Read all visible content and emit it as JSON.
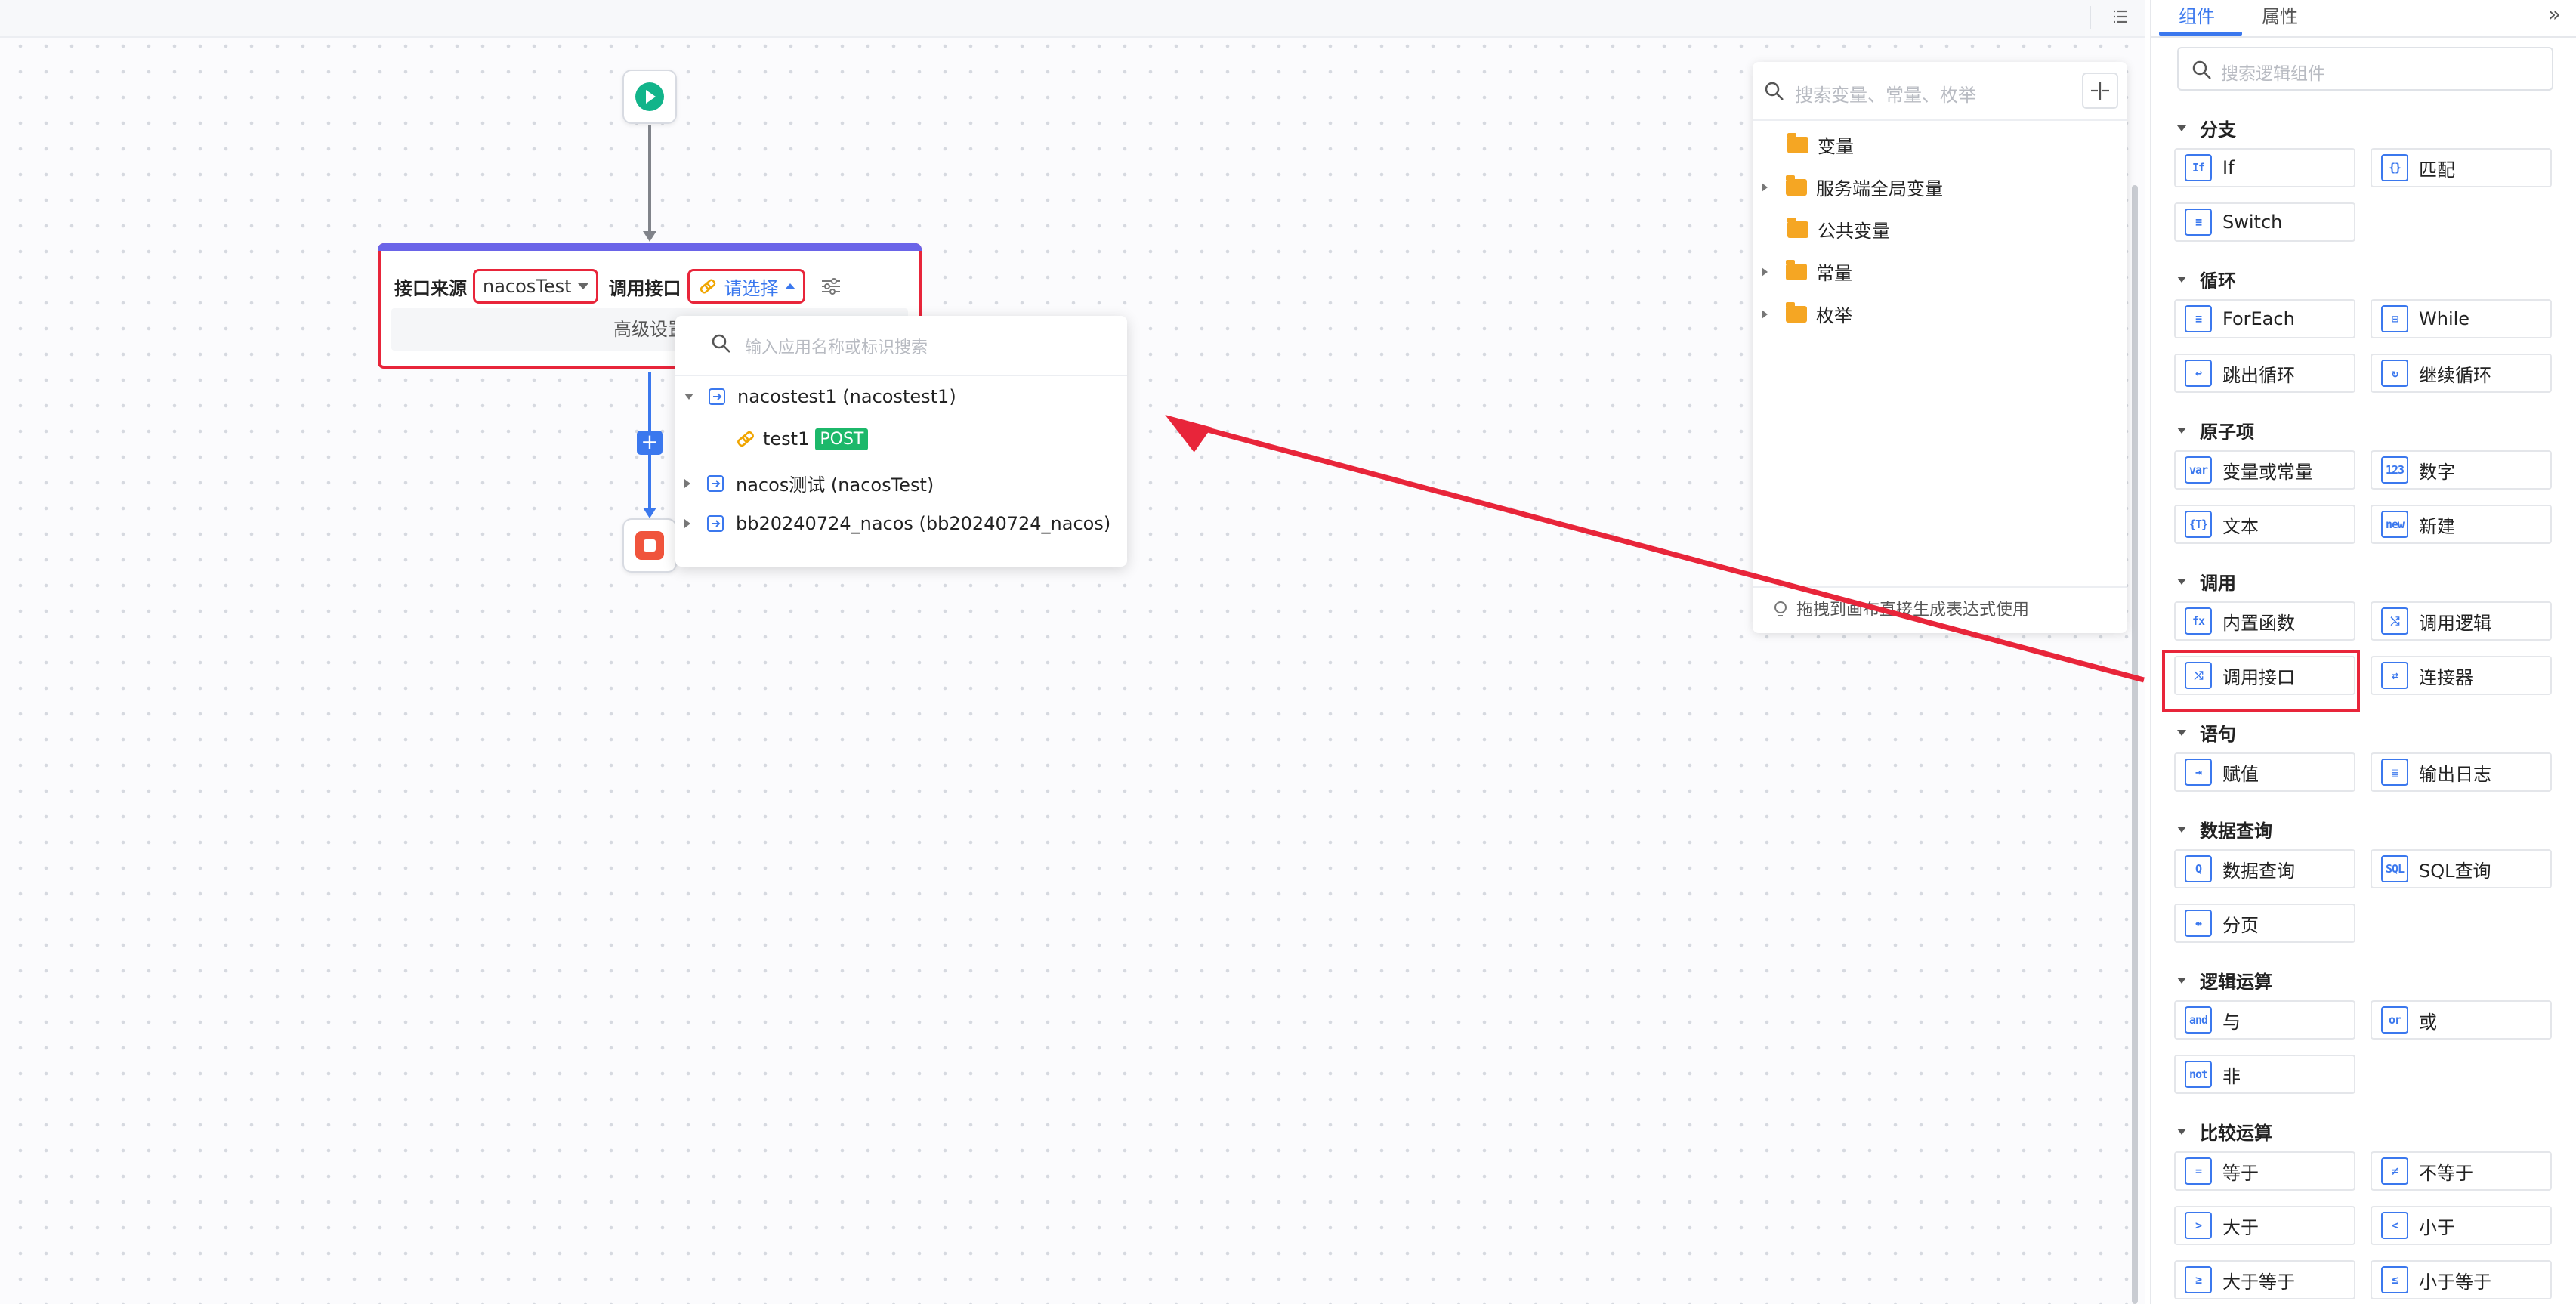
{
  "canvas": {
    "call_node": {
      "source_label": "接口来源",
      "source_value": "nacosTest",
      "api_label": "调用接口",
      "api_value": "请选择",
      "advanced_label": "高级设置"
    },
    "api_dropdown": {
      "search_placeholder": "输入应用名称或标识搜索",
      "items": [
        {
          "label": "nacostest1 (nacostest1)",
          "expanded": true
        },
        {
          "label": "test1",
          "method": "POST"
        },
        {
          "label": "nacos测试 (nacosTest)",
          "expanded": false
        },
        {
          "label": "bb20240724_nacos (bb20240724_nacos)",
          "expanded": false
        }
      ]
    }
  },
  "variables_panel": {
    "search_placeholder": "搜索变量、常量、枚举",
    "items": [
      {
        "label": "变量",
        "has_children": false
      },
      {
        "label": "服务端全局变量",
        "has_children": true
      },
      {
        "label": "公共变量",
        "has_children": false
      },
      {
        "label": "常量",
        "has_children": true
      },
      {
        "label": "枚举",
        "has_children": true
      }
    ],
    "footer": "拖拽到画布直接生成表达式使用"
  },
  "right_panel": {
    "tabs": [
      {
        "label": "组件",
        "active": true
      },
      {
        "label": "属性",
        "active": false
      }
    ],
    "search_placeholder": "搜索逻辑组件",
    "categories": {
      "branch": {
        "title": "分支",
        "items": [
          {
            "icon": "If",
            "label": "If"
          },
          {
            "icon": "{}",
            "label": "匹配"
          },
          {
            "icon": "≡",
            "label": "Switch"
          }
        ]
      },
      "loop": {
        "title": "循环",
        "items": [
          {
            "icon": "≡",
            "label": "ForEach"
          },
          {
            "icon": "⊟",
            "label": "While"
          },
          {
            "icon": "↩",
            "label": "跳出循环"
          },
          {
            "icon": "↻",
            "label": "继续循环"
          }
        ]
      },
      "atom": {
        "title": "原子项",
        "items": [
          {
            "icon": "var",
            "label": "变量或常量"
          },
          {
            "icon": "123",
            "label": "数字"
          },
          {
            "icon": "{T}",
            "label": "文本"
          },
          {
            "icon": "new",
            "label": "新建"
          }
        ]
      },
      "call": {
        "title": "调用",
        "items": [
          {
            "icon": "fx",
            "label": "内置函数"
          },
          {
            "icon": "⤭",
            "label": "调用逻辑"
          },
          {
            "icon": "⤭",
            "label": "调用接口"
          },
          {
            "icon": "⇄",
            "label": "连接器"
          }
        ]
      },
      "statement": {
        "title": "语句",
        "items": [
          {
            "icon": "⇥",
            "label": "赋值"
          },
          {
            "icon": "▤",
            "label": "输出日志"
          }
        ]
      },
      "query": {
        "title": "数据查询",
        "items": [
          {
            "icon": "Q",
            "label": "数据查询"
          },
          {
            "icon": "SQL",
            "label": "SQL查询"
          },
          {
            "icon": "⇹",
            "label": "分页"
          }
        ]
      },
      "logic": {
        "title": "逻辑运算",
        "items": [
          {
            "icon": "and",
            "label": "与"
          },
          {
            "icon": "or",
            "label": "或"
          },
          {
            "icon": "not",
            "label": "非"
          }
        ]
      },
      "compare": {
        "title": "比较运算",
        "items": [
          {
            "icon": "=",
            "label": "等于"
          },
          {
            "icon": "≠",
            "label": "不等于"
          },
          {
            "icon": ">",
            "label": "大于"
          },
          {
            "icon": "<",
            "label": "小于"
          },
          {
            "icon": "≥",
            "label": "大于等于"
          },
          {
            "icon": "≤",
            "label": "小于等于"
          }
        ]
      }
    }
  },
  "colors": {
    "accent": "#3b78ee",
    "highlight": "#e8253a",
    "start": "#12b48a",
    "stop": "#f0543c",
    "folder": "#f5a623",
    "post": "#1cb86a"
  }
}
